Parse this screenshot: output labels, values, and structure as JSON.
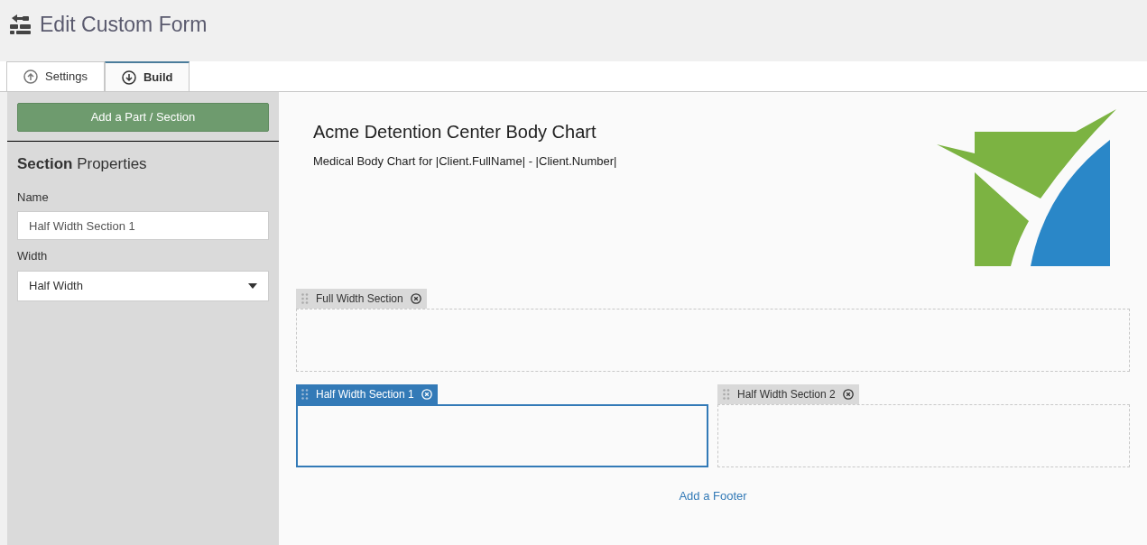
{
  "page_title": "Edit Custom Form",
  "tabs": [
    {
      "label": "Settings",
      "kind": "up",
      "selected": false
    },
    {
      "label": "Build",
      "kind": "down",
      "selected": true
    }
  ],
  "sidebar": {
    "add_button": "Add a Part / Section",
    "heading_bold": "Section",
    "heading_rest": "Properties",
    "fields": [
      {
        "label": "Name",
        "kind": "text",
        "value": "Half Width Section 1"
      },
      {
        "label": "Width",
        "kind": "select",
        "value": "Half Width"
      }
    ]
  },
  "form": {
    "title": "Acme Detention Center Body Chart",
    "subtitle": "Medical Body Chart for |Client.FullName| - |Client.Number|",
    "sections": [
      {
        "name": "Full Width Section",
        "kind": "full",
        "selected": false
      },
      {
        "name": "Half Width Section 1",
        "kind": "half",
        "selected": true
      },
      {
        "name": "Half Width Section 2",
        "kind": "half",
        "selected": false
      }
    ],
    "footer_link": "Add a Footer"
  }
}
